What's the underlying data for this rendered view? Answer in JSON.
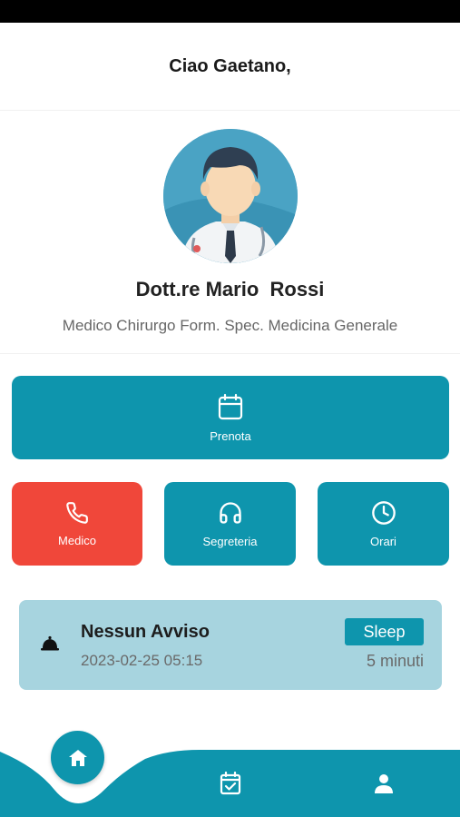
{
  "greeting": "Ciao Gaetano,",
  "doctor": {
    "name": "Dott.re Mario  Rossi",
    "specialty": "Medico Chirurgo Form. Spec. Medicina Generale"
  },
  "actions": {
    "prenota": "Prenota",
    "medico": "Medico",
    "segreteria": "Segreteria",
    "orari": "Orari"
  },
  "notice": {
    "title": "Nessun Avviso",
    "datetime": "2023-02-25 05:15",
    "sleep_label": "Sleep",
    "duration": "5 minuti"
  },
  "colors": {
    "primary": "#0e95ad",
    "danger": "#f0473a",
    "notice_bg": "#a7d4df"
  },
  "nav_icons": [
    "home-icon",
    "calendar-check-icon",
    "user-icon"
  ]
}
